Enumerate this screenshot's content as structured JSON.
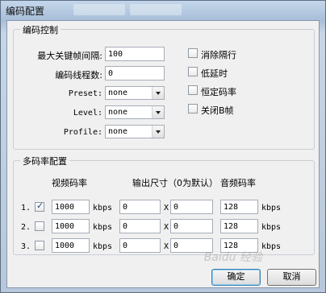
{
  "window": {
    "title": "编码配置"
  },
  "encoding": {
    "group_title": "编码控制",
    "max_keyframe_interval_label": "最大关键帧间隔:",
    "max_keyframe_interval_value": "100",
    "encode_threads_label": "编码线程数:",
    "encode_threads_value": "0",
    "preset_label": "Preset:",
    "preset_value": "none",
    "level_label": "Level:",
    "level_value": "none",
    "profile_label": "Profile:",
    "profile_value": "none",
    "options": [
      {
        "label": "消除隔行",
        "checked": false
      },
      {
        "label": "低延时",
        "checked": false
      },
      {
        "label": "恒定码率",
        "checked": false
      },
      {
        "label": "关闭B帧",
        "checked": false
      }
    ]
  },
  "multirate": {
    "group_title": "多码率配置",
    "col_video": "视频码率",
    "col_size": "输出尺寸（0为默认）",
    "col_audio": "音频码率",
    "unit": "kbps",
    "x_sep": "X",
    "rows": [
      {
        "index": "1.",
        "checked": true,
        "video": "1000",
        "width": "0",
        "height": "0",
        "audio": "128"
      },
      {
        "index": "2.",
        "checked": false,
        "video": "1000",
        "width": "0",
        "height": "0",
        "audio": "128"
      },
      {
        "index": "3.",
        "checked": false,
        "video": "1000",
        "width": "0",
        "height": "0",
        "audio": "128"
      }
    ]
  },
  "buttons": {
    "ok": "确定",
    "cancel": "取消"
  },
  "watermark": "Baidu 经验"
}
